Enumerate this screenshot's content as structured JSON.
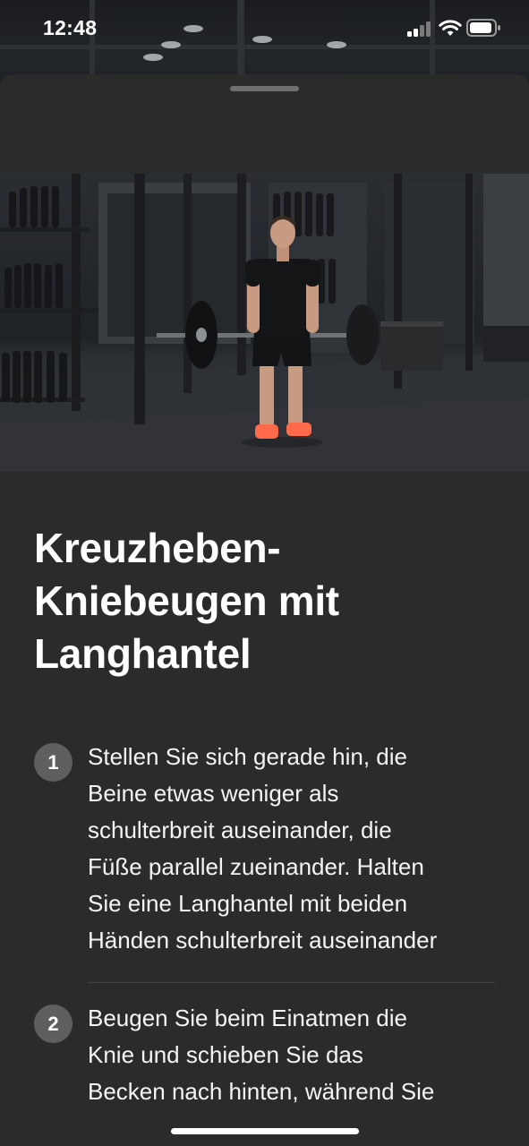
{
  "status_bar": {
    "time": "12:48"
  },
  "exercise": {
    "title_lines": [
      "Kreuzheben-",
      "Kniebeugen mit",
      "Langhantel"
    ],
    "image_icon": "exercise-photo",
    "steps": [
      {
        "number": "1",
        "lines": [
          "Stellen Sie sich gerade hin, die",
          "Beine etwas weniger als",
          "schulterbreit auseinander, die",
          "Füße parallel zueinander. Halten",
          "Sie eine Langhantel mit beiden",
          "Händen schulterbreit auseinander"
        ]
      },
      {
        "number": "2",
        "lines": [
          "Beugen Sie beim Einatmen die",
          "Knie und schieben Sie das",
          "Becken nach hinten, während Sie"
        ]
      }
    ]
  },
  "colors": {
    "sheet_background": "#2b2b2b",
    "step_badge": "#5f5f5f",
    "text": "#ffffff"
  }
}
